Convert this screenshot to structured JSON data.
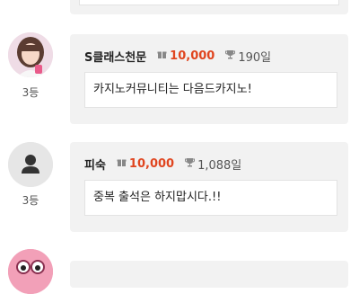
{
  "comments": [
    {
      "nickname": "S클래스천문",
      "points": "10,000",
      "days": "190일",
      "text": "카지노커뮤니티는 다음드카지노!",
      "rank": "3등",
      "avatar": "photo-avatar"
    },
    {
      "nickname": "피숙",
      "points": "10,000",
      "days": "1,088일",
      "text": "중복 출석은 하지맙시다.!!",
      "rank": "3등",
      "avatar": "default-user-icon"
    }
  ],
  "icons": {
    "points": "point-gift-icon",
    "attendance": "trophy-icon"
  },
  "colors": {
    "points": "#e0451f",
    "card_bg": "#f2f2f2",
    "avatar_default_bg": "#e6e6e6"
  }
}
